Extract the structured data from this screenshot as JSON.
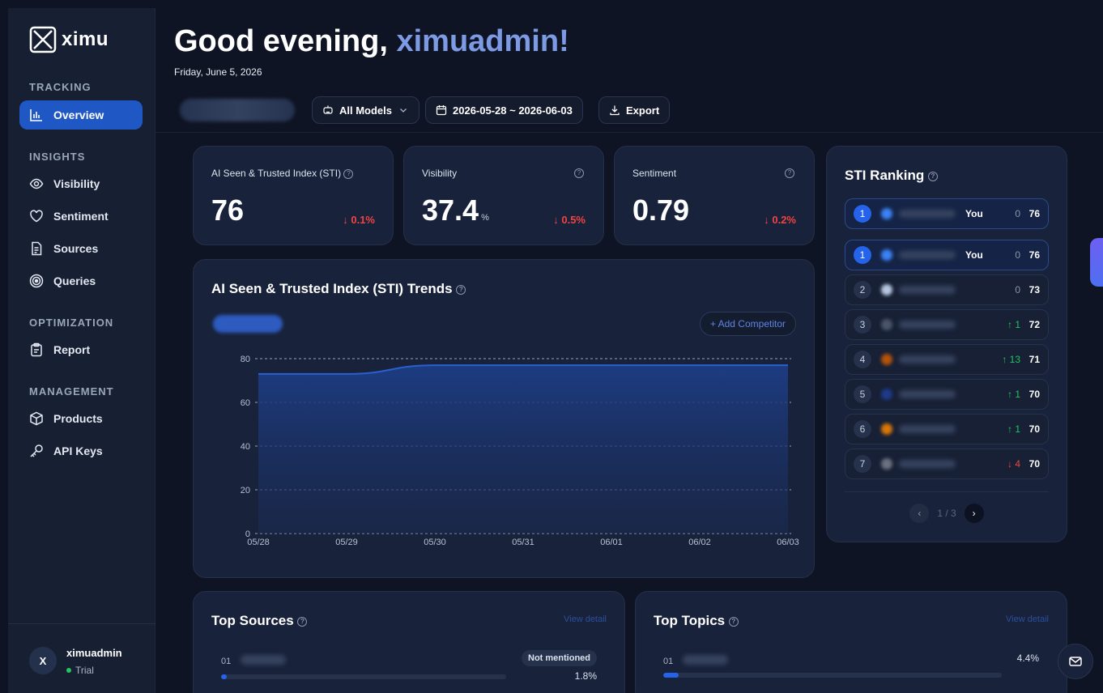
{
  "app": {
    "logo_text": "ximu"
  },
  "sidebar": {
    "sections": [
      {
        "title": "TRACKING"
      },
      {
        "title": "INSIGHTS"
      },
      {
        "title": "OPTIMIZATION"
      },
      {
        "title": "MANAGEMENT"
      }
    ],
    "items": [
      {
        "label": "Overview",
        "icon": "bar-chart-icon",
        "active": true
      },
      {
        "label": "Visibility",
        "icon": "eye-icon"
      },
      {
        "label": "Sentiment",
        "icon": "heart-icon"
      },
      {
        "label": "Sources",
        "icon": "document-icon"
      },
      {
        "label": "Queries",
        "icon": "target-icon"
      },
      {
        "label": "Report",
        "icon": "clipboard-icon"
      },
      {
        "label": "Products",
        "icon": "box-icon"
      },
      {
        "label": "API Keys",
        "icon": "key-icon"
      }
    ],
    "user": {
      "avatar_letter": "X",
      "name": "ximuadmin",
      "plan": "Trial"
    }
  },
  "header": {
    "greeting_prefix": "Good evening, ",
    "greeting_name": "ximuadmin!",
    "date": "Friday, June 5, 2026",
    "models_label": "All Models",
    "date_range": "2026-05-28 ~ 2026-06-03",
    "export_label": "Export"
  },
  "kpis": [
    {
      "label": "AI Seen & Trusted Index (STI)",
      "value": "76",
      "unit": "",
      "delta": "0.1%"
    },
    {
      "label": "Visibility",
      "value": "37.4",
      "unit": "%",
      "delta": "0.5%"
    },
    {
      "label": "Sentiment",
      "value": "0.79",
      "unit": "",
      "delta": "0.2%"
    }
  ],
  "trends": {
    "title": "AI Seen & Trusted Index (STI) Trends",
    "add_competitor": "+ Add Competitor"
  },
  "chart_data": {
    "type": "area",
    "title": "AI Seen & Trusted Index (STI) Trends",
    "x": [
      "05/28",
      "05/29",
      "05/30",
      "05/31",
      "06/01",
      "06/02",
      "06/03"
    ],
    "series": [
      {
        "values": [
          73,
          73,
          77,
          77,
          77,
          77,
          77
        ]
      }
    ],
    "ylim": [
      0,
      80
    ],
    "yticks": [
      "0",
      "20",
      "40",
      "60",
      "80"
    ],
    "grid": true,
    "color": "#1f4fb3"
  },
  "ranking": {
    "title": "STI Ranking",
    "you_label": "You",
    "pinned": {
      "rank": "1",
      "delta": "0",
      "score": "76",
      "dir": "flat",
      "logo": "#3b82f6"
    },
    "rows": [
      {
        "rank": "1",
        "delta": "0",
        "score": "76",
        "dir": "flat",
        "you": true,
        "logo": "#3b82f6"
      },
      {
        "rank": "2",
        "delta": "0",
        "score": "73",
        "dir": "flat",
        "logo": "#b8c7e0"
      },
      {
        "rank": "3",
        "delta": "↑ 1",
        "score": "72",
        "dir": "up",
        "logo": "#4b5568"
      },
      {
        "rank": "4",
        "delta": "↑ 13",
        "score": "71",
        "dir": "up",
        "logo": "#b45309"
      },
      {
        "rank": "5",
        "delta": "↑ 1",
        "score": "70",
        "dir": "up",
        "logo": "#1e3a8a"
      },
      {
        "rank": "6",
        "delta": "↑ 1",
        "score": "70",
        "dir": "up",
        "logo": "#d97706"
      },
      {
        "rank": "7",
        "delta": "↓ 4",
        "score": "70",
        "dir": "down",
        "logo": "#6b7280"
      }
    ],
    "pager": "1 / 3"
  },
  "top_sources": {
    "title": "Top Sources",
    "view_detail": "View detail",
    "items": [
      {
        "index": "01",
        "badge": "Not mentioned",
        "pct": "1.8%",
        "fill": 0.02
      }
    ]
  },
  "top_topics": {
    "title": "Top Topics",
    "view_detail": "View detail",
    "items": [
      {
        "index": "01",
        "pct": "4.4%",
        "fill": 0.045
      }
    ]
  }
}
